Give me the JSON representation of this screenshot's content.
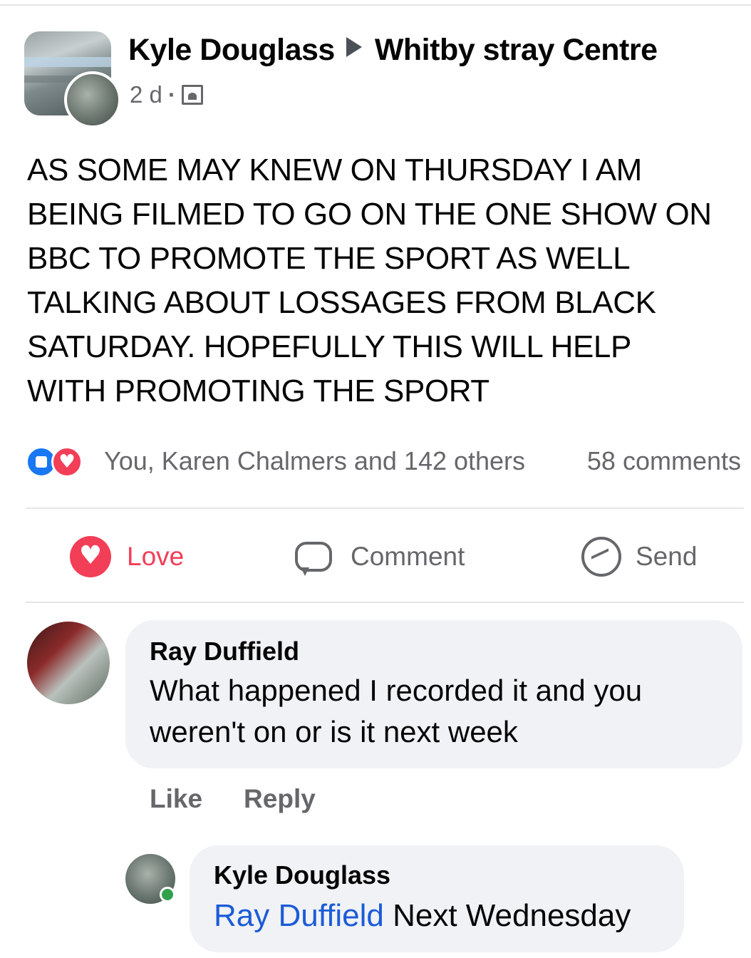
{
  "post": {
    "author": "Kyle Douglass",
    "group": "Whitby stray Centre",
    "time": "2 d",
    "separator": "·",
    "audience_icon": "group-audience-icon",
    "body": "AS SOME MAY KNEW ON THURSDAY I AM\nBEING FILMED TO GO ON THE ONE SHOW ON\nBBC TO PROMOTE THE SPORT AS WELL\nTALKING ABOUT LOSSAGES FROM BLACK\nSATURDAY. HOPEFULLY THIS WILL HELP\nWITH PROMOTING THE SPORT"
  },
  "reactions": {
    "summary": "You, Karen Chalmers and 142 others",
    "comments_count": "58 comments"
  },
  "actions": {
    "love_label": "Love",
    "comment_label": "Comment",
    "send_label": "Send"
  },
  "comments": [
    {
      "author": "Ray Duffield",
      "text": "What happened I recorded it and you weren't on or is it next week",
      "like_label": "Like",
      "reply_label": "Reply"
    },
    {
      "author": "Kyle Douglass",
      "mention": "Ray Duffield",
      "text": " Next Wednesday"
    }
  ],
  "colors": {
    "love": "#f33e58",
    "like": "#1877f2",
    "mention": "#1b5bd8",
    "secondary_text": "#65676b",
    "bubble_bg": "#f0f2f5",
    "online": "#31a24c"
  }
}
